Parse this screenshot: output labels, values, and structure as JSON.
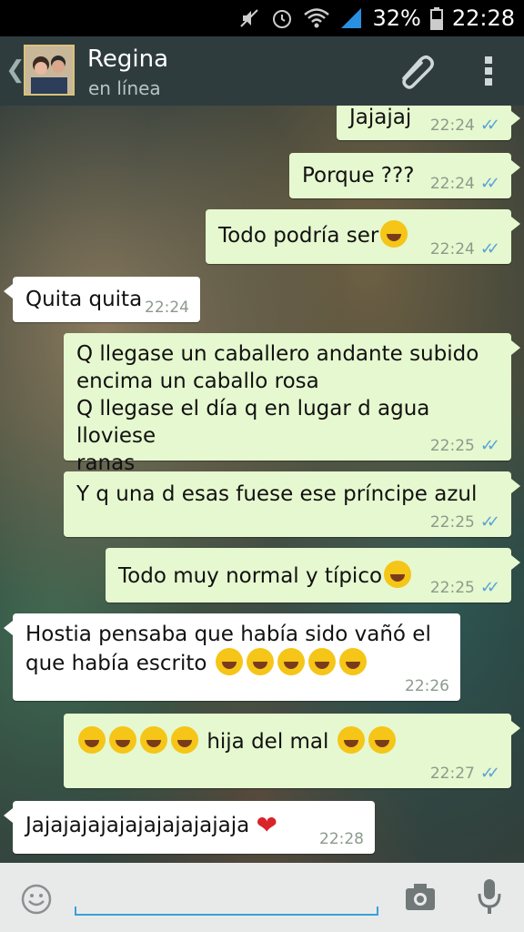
{
  "status_bar": {
    "battery": "32%",
    "time": "22:28"
  },
  "contact": {
    "name": "Regina",
    "status": "en línea"
  },
  "messages": [
    {
      "dir": "out",
      "text": "Jajajaj",
      "time": "22:24"
    },
    {
      "dir": "out",
      "text": "Porque ???",
      "time": "22:24"
    },
    {
      "dir": "out",
      "text": "Todo podría ser",
      "time": "22:24"
    },
    {
      "dir": "in",
      "text": "Quita quita",
      "time": "22:24"
    },
    {
      "dir": "out",
      "text": "Q llegase un caballero andante subido\nencima un caballo rosa\nQ llegase el día q en lugar d agua lloviese\nranas",
      "time": "22:25"
    },
    {
      "dir": "out",
      "text": "Y q una d esas fuese ese príncipe azul",
      "time": "22:25"
    },
    {
      "dir": "out",
      "text": "Todo muy normal y típico",
      "time": "22:25"
    },
    {
      "dir": "in",
      "text": "Hostia pensaba que había sido vañó el\nque había escrito",
      "time": "22:26"
    },
    {
      "dir": "out",
      "text": "hija del mal",
      "time": "22:27"
    },
    {
      "dir": "in",
      "text": "Jajajajajajajajajajajaja",
      "time": "22:28"
    }
  ],
  "icons": {
    "back": "chevron-left-icon",
    "attach": "paperclip-icon",
    "menu": "overflow-menu-icon",
    "emoji": "smiley-icon",
    "camera": "camera-icon",
    "mic": "microphone-icon",
    "laugh": "tears-of-joy-emoji",
    "weary": "weary-face-emoji",
    "heart": "heart-emoji"
  },
  "colors": {
    "outgoing": "#e6f8cf",
    "incoming": "#ffffff",
    "read_ticks": "#5aa3d8",
    "header": "#2e3c3e"
  }
}
